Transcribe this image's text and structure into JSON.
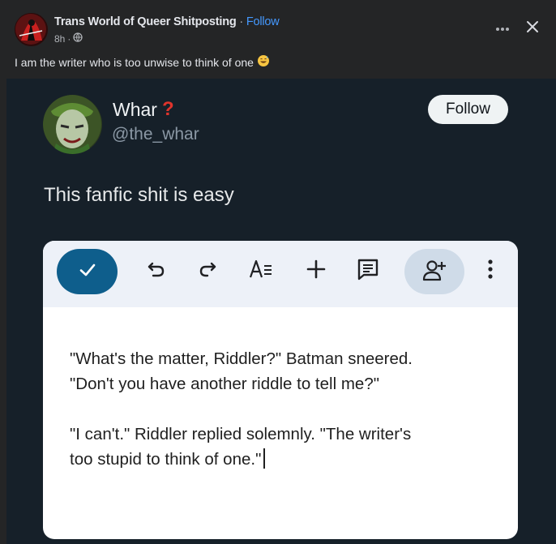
{
  "post": {
    "page_name": "Trans World of Queer Shitposting",
    "separator": " · ",
    "follow_label": "Follow",
    "time": "8h",
    "meta_separator": "·",
    "caption": "I am the writer who is too unwise to think of one",
    "icons": {
      "more": "more-horizontal-icon",
      "close": "close-icon",
      "audience": "globe-icon",
      "emoji": "grinning-sweat-emoji"
    }
  },
  "tweet": {
    "display_name": "Whar",
    "name_emoji": "❓",
    "handle": "@the_whar",
    "follow_label": "Follow",
    "text": "This fanfic shit is easy"
  },
  "doc": {
    "toolbar_icons": [
      "check-icon",
      "undo-icon",
      "redo-icon",
      "text-format-icon",
      "insert-icon",
      "comment-icon",
      "share-icon",
      "more-vertical-icon"
    ],
    "paragraph1_line1": "\"What's the matter, Riddler?\" Batman sneered.",
    "paragraph1_line2": "\"Don't you have another riddle to tell me?\"",
    "paragraph2_line1": "\"I can't.\" Riddler replied solemnly. \"The writer's",
    "paragraph2_line2": "too stupid to think of one.\""
  },
  "colors": {
    "facebook_bg": "#242526",
    "facebook_link": "#4599ff",
    "tweet_bg": "#162029",
    "doc_toolbar": "#edf1f8",
    "check_button": "#0e5e8c"
  }
}
